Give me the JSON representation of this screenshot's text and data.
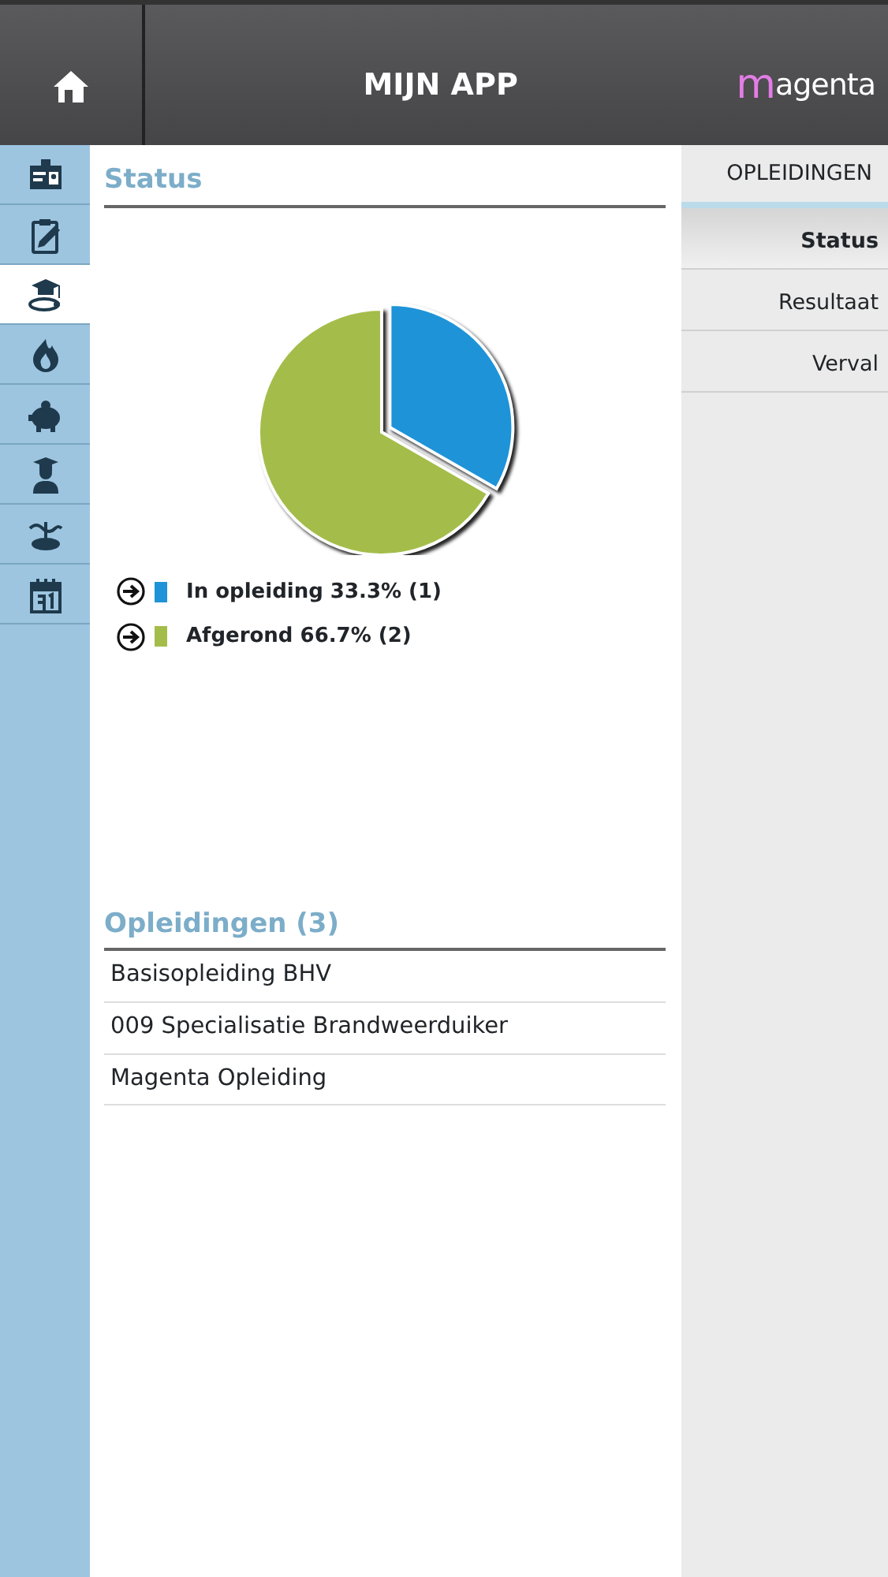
{
  "header": {
    "title": "MIJN APP",
    "logo": "magenta"
  },
  "sidebar": {
    "items": [
      {
        "selected": false
      },
      {
        "selected": false
      },
      {
        "selected": true
      },
      {
        "selected": false
      },
      {
        "selected": false
      },
      {
        "selected": false
      },
      {
        "selected": false
      },
      {
        "selected": false
      }
    ]
  },
  "status": {
    "title": "Status",
    "chart_data": {
      "type": "pie",
      "values": [
        33.3,
        66.7
      ]
    },
    "legend": [
      {
        "label": "In opleiding 33.3% (1)",
        "color": "#1e93d8"
      },
      {
        "label": "Afgerond 66.7% (2)",
        "color": "#a4bd4a"
      }
    ]
  },
  "courses": {
    "title": "Opleidingen (3)",
    "items": [
      "Basisopleiding BHV",
      "009 Specialisatie Brandweerduiker",
      "Magenta Opleiding"
    ]
  },
  "menu": {
    "title": "OPLEIDINGEN",
    "items": [
      {
        "label": "Status",
        "selected": true
      },
      {
        "label": "Resultaat",
        "selected": false
      },
      {
        "label": "Verval",
        "selected": false
      }
    ]
  }
}
